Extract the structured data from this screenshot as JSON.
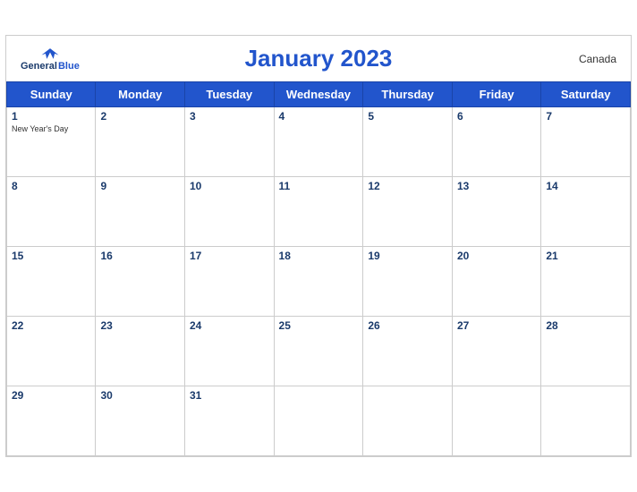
{
  "header": {
    "title": "January 2023",
    "country": "Canada",
    "logo": {
      "general": "General",
      "blue": "Blue"
    }
  },
  "days_of_week": [
    "Sunday",
    "Monday",
    "Tuesday",
    "Wednesday",
    "Thursday",
    "Friday",
    "Saturday"
  ],
  "weeks": [
    [
      {
        "num": "1",
        "holiday": "New Year's Day"
      },
      {
        "num": "2",
        "holiday": ""
      },
      {
        "num": "3",
        "holiday": ""
      },
      {
        "num": "4",
        "holiday": ""
      },
      {
        "num": "5",
        "holiday": ""
      },
      {
        "num": "6",
        "holiday": ""
      },
      {
        "num": "7",
        "holiday": ""
      }
    ],
    [
      {
        "num": "8",
        "holiday": ""
      },
      {
        "num": "9",
        "holiday": ""
      },
      {
        "num": "10",
        "holiday": ""
      },
      {
        "num": "11",
        "holiday": ""
      },
      {
        "num": "12",
        "holiday": ""
      },
      {
        "num": "13",
        "holiday": ""
      },
      {
        "num": "14",
        "holiday": ""
      }
    ],
    [
      {
        "num": "15",
        "holiday": ""
      },
      {
        "num": "16",
        "holiday": ""
      },
      {
        "num": "17",
        "holiday": ""
      },
      {
        "num": "18",
        "holiday": ""
      },
      {
        "num": "19",
        "holiday": ""
      },
      {
        "num": "20",
        "holiday": ""
      },
      {
        "num": "21",
        "holiday": ""
      }
    ],
    [
      {
        "num": "22",
        "holiday": ""
      },
      {
        "num": "23",
        "holiday": ""
      },
      {
        "num": "24",
        "holiday": ""
      },
      {
        "num": "25",
        "holiday": ""
      },
      {
        "num": "26",
        "holiday": ""
      },
      {
        "num": "27",
        "holiday": ""
      },
      {
        "num": "28",
        "holiday": ""
      }
    ],
    [
      {
        "num": "29",
        "holiday": ""
      },
      {
        "num": "30",
        "holiday": ""
      },
      {
        "num": "31",
        "holiday": ""
      },
      {
        "num": "",
        "holiday": ""
      },
      {
        "num": "",
        "holiday": ""
      },
      {
        "num": "",
        "holiday": ""
      },
      {
        "num": "",
        "holiday": ""
      }
    ]
  ]
}
